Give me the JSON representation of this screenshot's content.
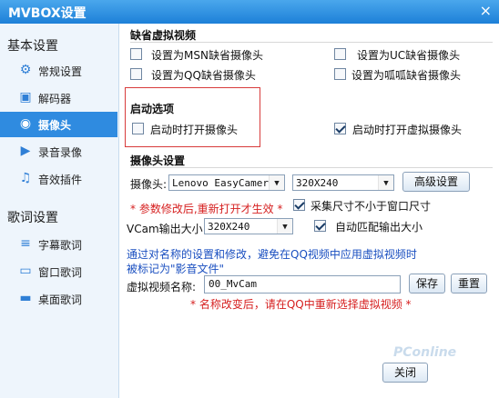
{
  "window": {
    "title": "MVBOX设置",
    "close_glyph": "×"
  },
  "sidebar": {
    "basic_header": "基本设置",
    "basic_items": [
      {
        "label": "常规设置",
        "icon": "gear-icon"
      },
      {
        "label": "解码器",
        "icon": "chip-icon"
      },
      {
        "label": "摄像头",
        "icon": "camera-icon",
        "selected": true
      },
      {
        "label": "录音录像",
        "icon": "video-icon"
      },
      {
        "label": "音效插件",
        "icon": "music-note-icon"
      }
    ],
    "lyrics_header": "歌词设置",
    "lyrics_items": [
      {
        "label": "字幕歌词",
        "icon": "subtitle-icon"
      },
      {
        "label": "窗口歌词",
        "icon": "window-icon"
      },
      {
        "label": "桌面歌词",
        "icon": "desktop-icon"
      }
    ]
  },
  "default_camera": {
    "header": "缺省虚拟视频",
    "options": [
      {
        "label": "设置为MSN缺省摄像头",
        "checked": false
      },
      {
        "label": "设置为UC缺省摄像头",
        "checked": false
      },
      {
        "label": "设置为QQ缺省摄像头",
        "checked": false
      },
      {
        "label": "设置为呱呱缺省摄像头",
        "checked": false
      }
    ]
  },
  "startup": {
    "header": "启动选项",
    "open_camera": {
      "label": "启动时打开摄像头",
      "checked": false
    },
    "open_virtual": {
      "label": "启动时打开虚拟摄像头",
      "checked": true
    }
  },
  "camera_settings": {
    "header": "摄像头设置",
    "camera_label": "摄像头:",
    "camera_value": "Lenovo EasyCamera",
    "resolution_value": "320X240",
    "advanced_button": "高级设置",
    "param_note": "* 参数修改后,重新打开才生效 *",
    "capture_size": {
      "label": "采集尺寸不小于窗口尺寸",
      "checked": true
    },
    "vcam_label": "VCam输出大小:",
    "vcam_value": "320X240",
    "auto_match": {
      "label": "自动匹配输出大小",
      "checked": true
    },
    "info_line1": "通过对名称的设置和修改，避免在QQ视频中应用虚拟视频时",
    "info_line2": "被标记为\"影音文件\"",
    "name_label": "虚拟视频名称:",
    "name_value": "00_MvCam",
    "save_button": "保存",
    "reset_button": "重置",
    "rename_note": "* 名称改变后，请在QQ中重新选择虚拟视频 *"
  },
  "footer": {
    "close_button": "关闭",
    "watermark": "PConline"
  }
}
